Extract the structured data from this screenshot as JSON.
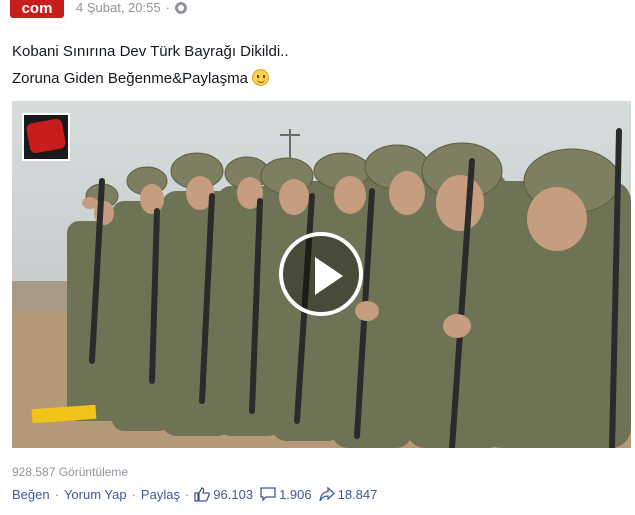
{
  "header": {
    "logo_text": "com",
    "timestamp": "4 Şubat, 20:55",
    "separator": "·"
  },
  "post": {
    "line1": "Kobani Sınırına Dev Türk Bayrağı Dikildi..",
    "line2": "Zoruna Giden Beğenme&Paylaşma"
  },
  "video": {
    "play_icon": "play-icon",
    "overlay_logo_icon": "channel-logo-icon"
  },
  "footer": {
    "views": "928.587 Görüntüleme",
    "actions": [
      {
        "label": "Beğen"
      },
      {
        "label": "Yorum Yap"
      },
      {
        "label": "Paylaş"
      }
    ],
    "separator": "·",
    "stats": {
      "likes": "96.103",
      "comments": "1.906",
      "shares": "18.847"
    }
  },
  "colors": {
    "link": "#3b5998",
    "muted": "#90949c",
    "brand_red": "#c81d1d"
  }
}
